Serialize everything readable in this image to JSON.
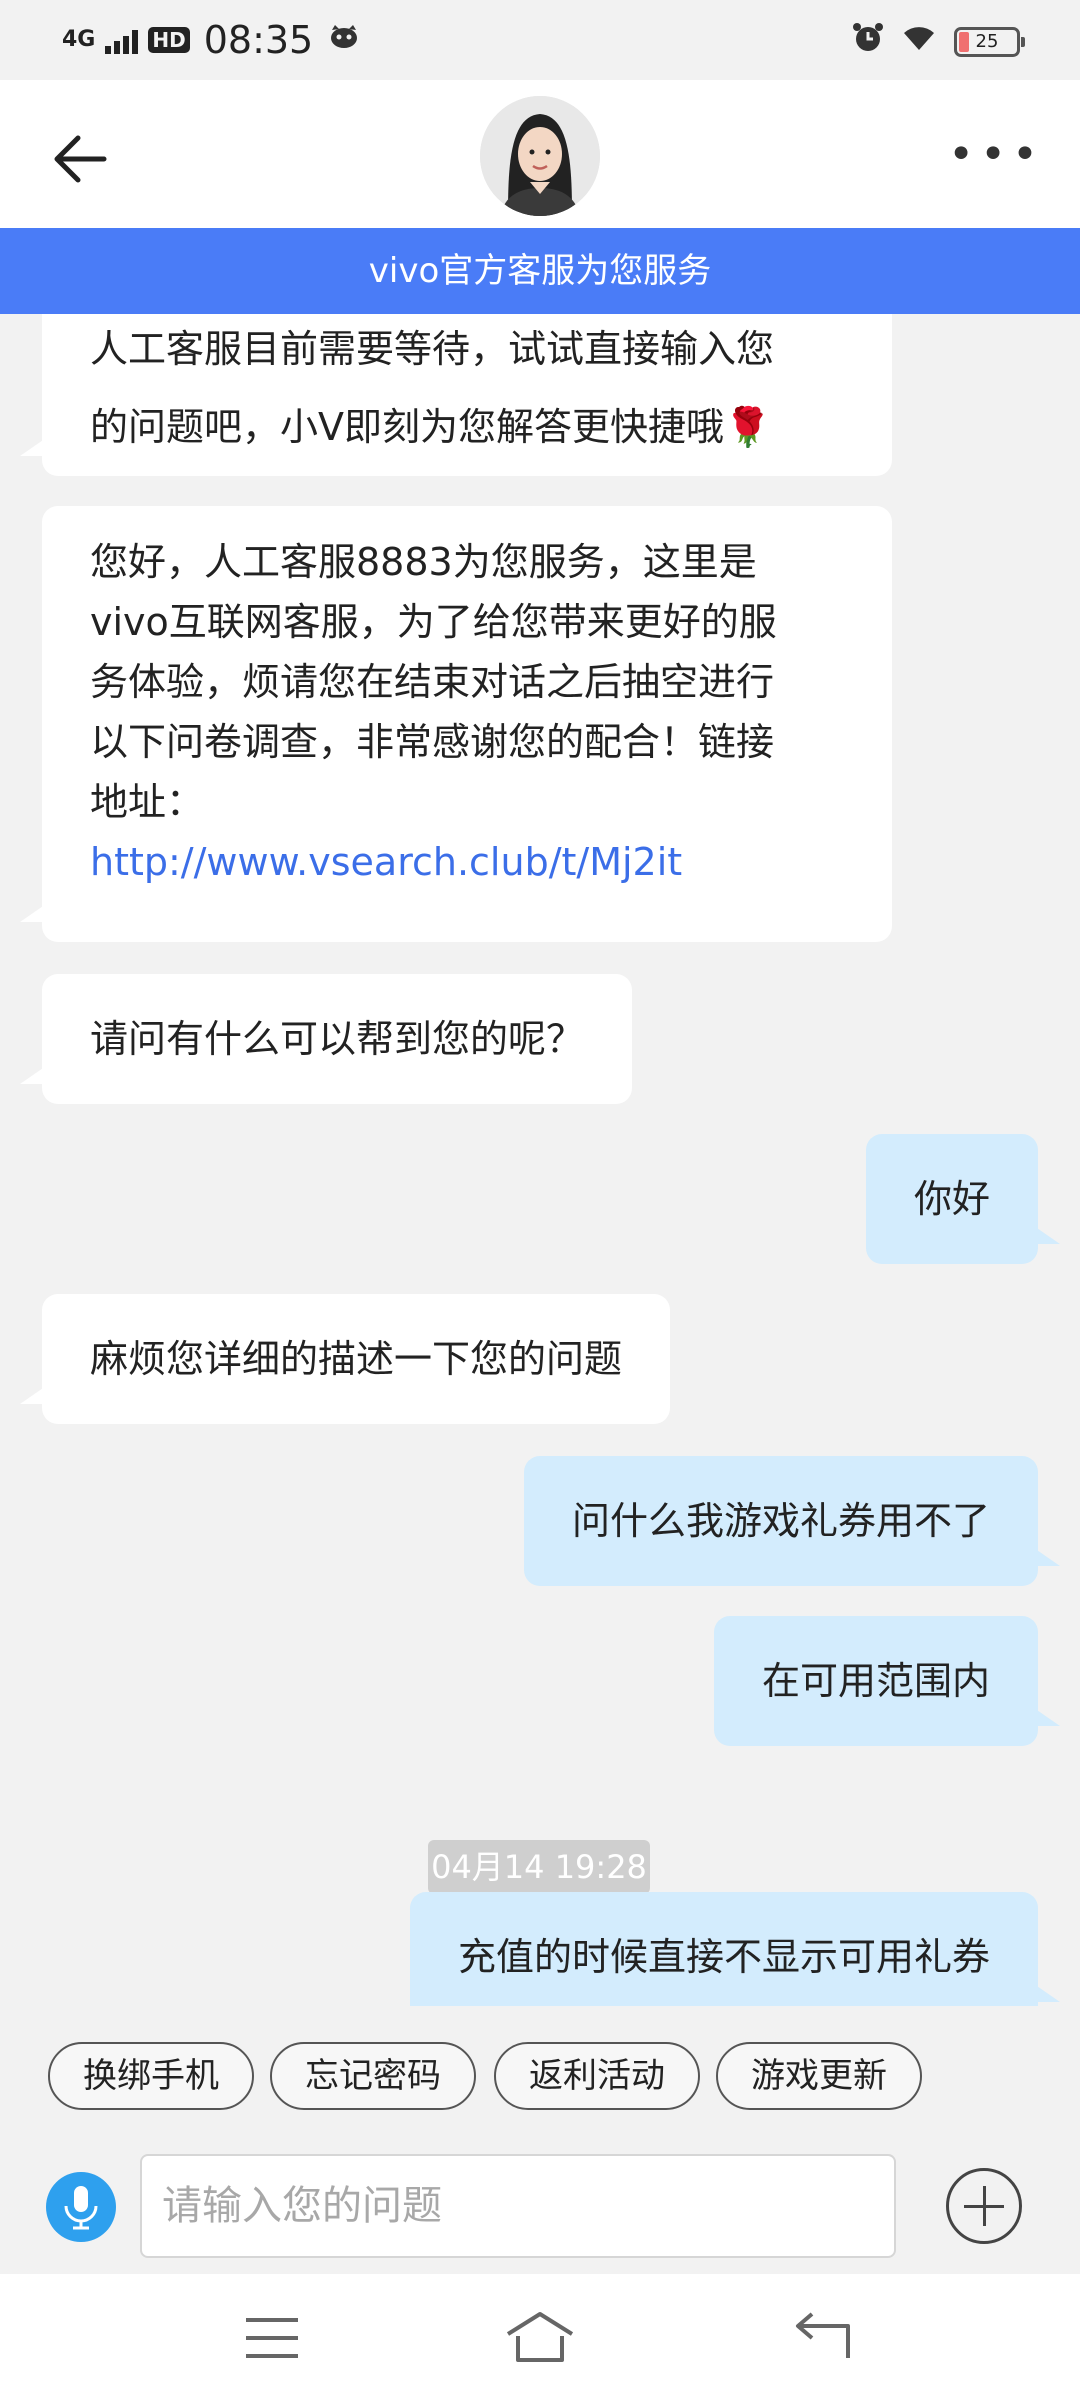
{
  "status_bar": {
    "network": "4G",
    "hd": "HD",
    "time": "08:35",
    "battery": "25"
  },
  "header": {
    "back_icon": "arrow-left-icon",
    "more_icon": "more-dots-icon",
    "avatar": "agent-avatar"
  },
  "banner": {
    "text": "vivo官方客服为您服务"
  },
  "messages": [
    {
      "side": "left",
      "lines": [
        "人工客服目前需要等待，试试直接输入您",
        "的问题吧，小V即刻为您解答更快捷哦🌹"
      ]
    },
    {
      "side": "left",
      "lines": [
        "您好，人工客服8883为您服务，这里是",
        "vivo互联网客服，为了给您带来更好的服",
        "务体验，烦请您在结束对话之后抽空进行",
        "以下问卷调查，非常感谢您的配合！链接",
        "地址："
      ],
      "link": "http://www.vsearch.club/t/Mj2it"
    },
    {
      "side": "left",
      "text": "请问有什么可以帮到您的呢？"
    },
    {
      "side": "right",
      "text": "你好"
    },
    {
      "side": "left",
      "text": "麻烦您详细的描述一下您的问题"
    },
    {
      "side": "right",
      "text": "问什么我游戏礼券用不了"
    },
    {
      "side": "right",
      "text": "在可用范围内"
    },
    {
      "side": "right",
      "text": "充值的时候直接不显示可用礼券"
    }
  ],
  "timestamp": "04月14 19:28",
  "quick_replies": [
    "换绑手机",
    "忘记密码",
    "返利活动",
    "游戏更新"
  ],
  "input": {
    "placeholder": "请输入您的问题"
  },
  "icons": {
    "mic": "microphone-icon",
    "plus": "plus-circle-icon",
    "nav_menu": "menu-lines-icon",
    "nav_home": "home-icon",
    "nav_back": "back-return-icon"
  },
  "colors": {
    "banner": "#4a7cf7",
    "agent_bubble": "#ffffff",
    "user_bubble": "#d3ecfd",
    "link": "#3b6ee8",
    "mic": "#2ea0ee"
  }
}
